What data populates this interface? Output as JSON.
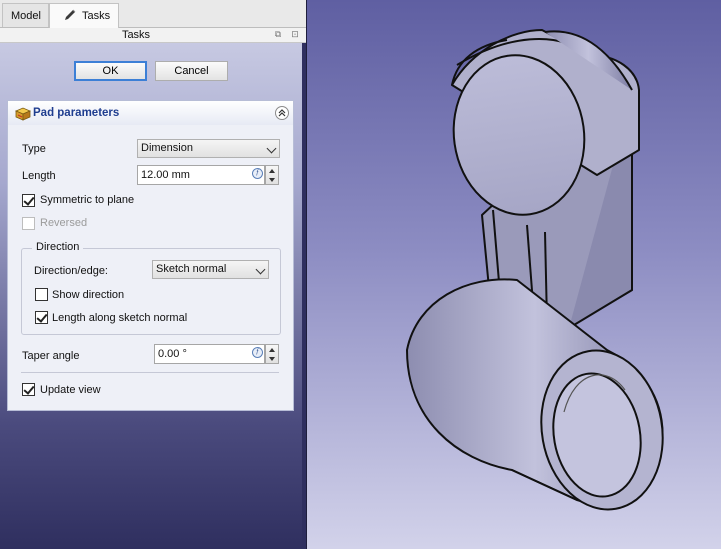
{
  "tabs": [
    {
      "label": "Model",
      "active": false
    },
    {
      "label": "Tasks",
      "active": true,
      "icon": "pencil-icon"
    }
  ],
  "dock": {
    "title": "Tasks"
  },
  "dialog": {
    "ok_label": "OK",
    "cancel_label": "Cancel"
  },
  "panel": {
    "title": "Pad parameters",
    "icon": "pad-icon",
    "type_label": "Type",
    "type_value": "Dimension",
    "length_label": "Length",
    "length_value": "12.00 mm",
    "symmetric_label": "Symmetric to plane",
    "symmetric_checked": true,
    "reversed_label": "Reversed",
    "reversed_checked": false,
    "reversed_enabled": false,
    "direction": {
      "group_label": "Direction",
      "edge_label": "Direction/edge:",
      "edge_value": "Sketch normal",
      "show_direction_label": "Show direction",
      "show_direction_checked": false,
      "along_normal_label": "Length along sketch normal",
      "along_normal_checked": true
    },
    "taper_label": "Taper angle",
    "taper_value": "0.00 °",
    "update_view_label": "Update view",
    "update_view_checked": true
  },
  "colors": {
    "dock_background": "#2f2f5f",
    "panel_title": "#1f3d8f",
    "ok_focus_border": "#3c7fd6",
    "model_face": "#b8b8d2"
  }
}
